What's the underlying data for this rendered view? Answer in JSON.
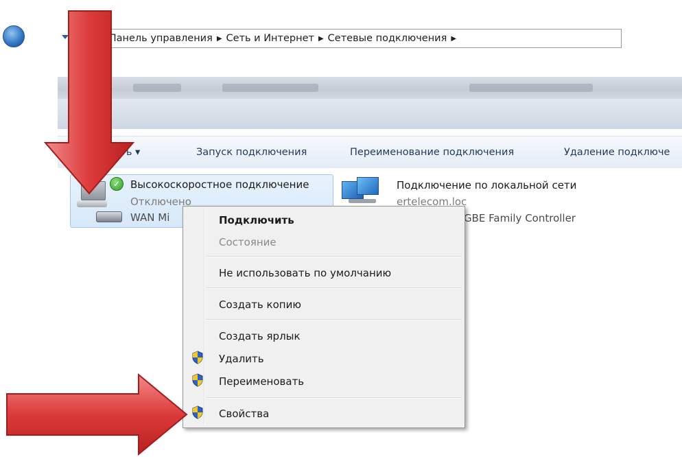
{
  "address": {
    "crumbs": [
      "Панель управления",
      "Сеть и Интернет",
      "Сетевые подключения"
    ]
  },
  "toolbar": {
    "organize": "ить ▾",
    "start_connection": "Запуск подключения",
    "rename_connection": "Переименование подключения",
    "delete_connection": "Удаление подключе"
  },
  "connections": {
    "highspeed": {
      "title": "Высокоскоростное подключение",
      "status": "Отключено",
      "device": "WAN Mi"
    },
    "lan": {
      "title": "Подключение по локальной сети",
      "domain": "ertelecom.loc",
      "device": "GBE Family Controller"
    }
  },
  "context_menu": {
    "connect": "Подключить",
    "status": "Состояние",
    "not_default": "Не использовать по умолчанию",
    "create_copy": "Создать копию",
    "create_shortcut": "Создать ярлык",
    "delete": "Удалить",
    "rename": "Переименовать",
    "properties": "Свойства"
  },
  "colors": {
    "arrow_red": "#d93a3a",
    "selection_blue": "#d6e8fa"
  }
}
